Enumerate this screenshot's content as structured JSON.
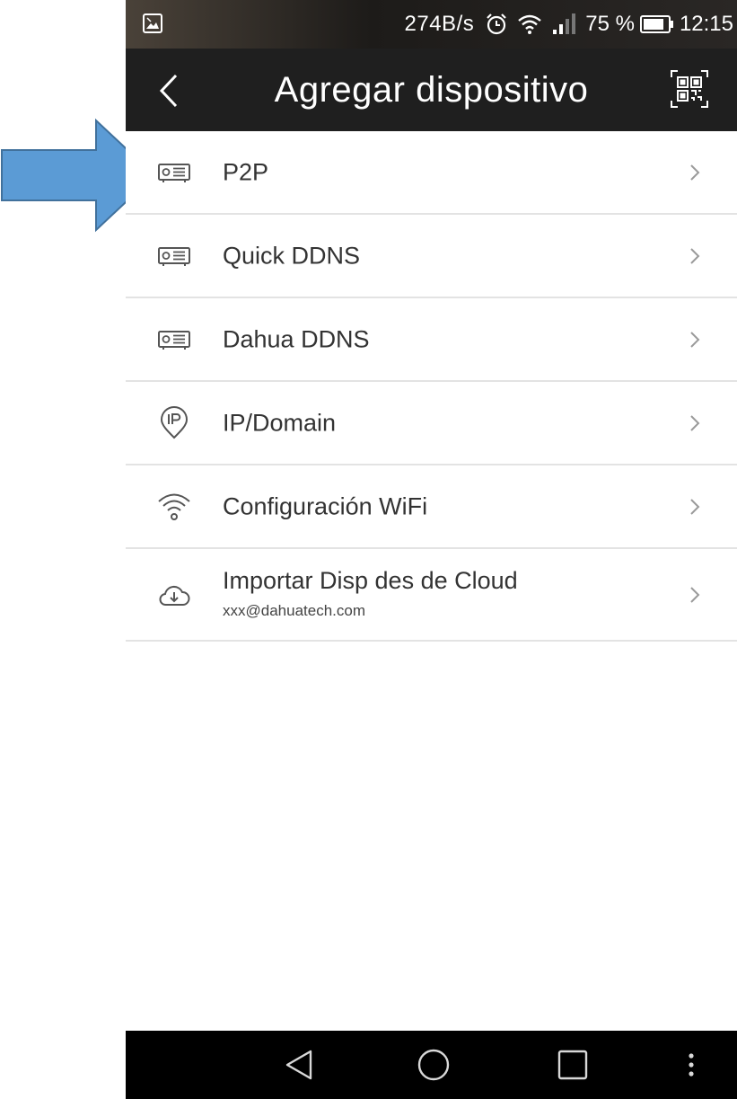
{
  "status_bar": {
    "network_speed": "274B/s",
    "battery_percent": "75 %",
    "time": "12:15"
  },
  "header": {
    "title": "Agregar dispositivo",
    "back_icon": "chevron-left-icon",
    "qr_icon": "qr-scan-icon"
  },
  "menu": {
    "items": [
      {
        "label": "P2P",
        "icon": "device-icon"
      },
      {
        "label": "Quick DDNS",
        "icon": "device-icon"
      },
      {
        "label": "Dahua DDNS",
        "icon": "device-icon"
      },
      {
        "label": "IP/Domain",
        "icon": "ip-pin-icon"
      },
      {
        "label": "Configuración WiFi",
        "icon": "wifi-icon"
      },
      {
        "label": "Importar Disp des de Cloud",
        "sublabel": "xxx@dahuatech.com",
        "icon": "cloud-download-icon"
      }
    ]
  },
  "colors": {
    "app_bar": "#1f1f1f",
    "arrow_fill": "#5b9bd5",
    "arrow_stroke": "#41719c",
    "divider": "#e3e3e3"
  }
}
